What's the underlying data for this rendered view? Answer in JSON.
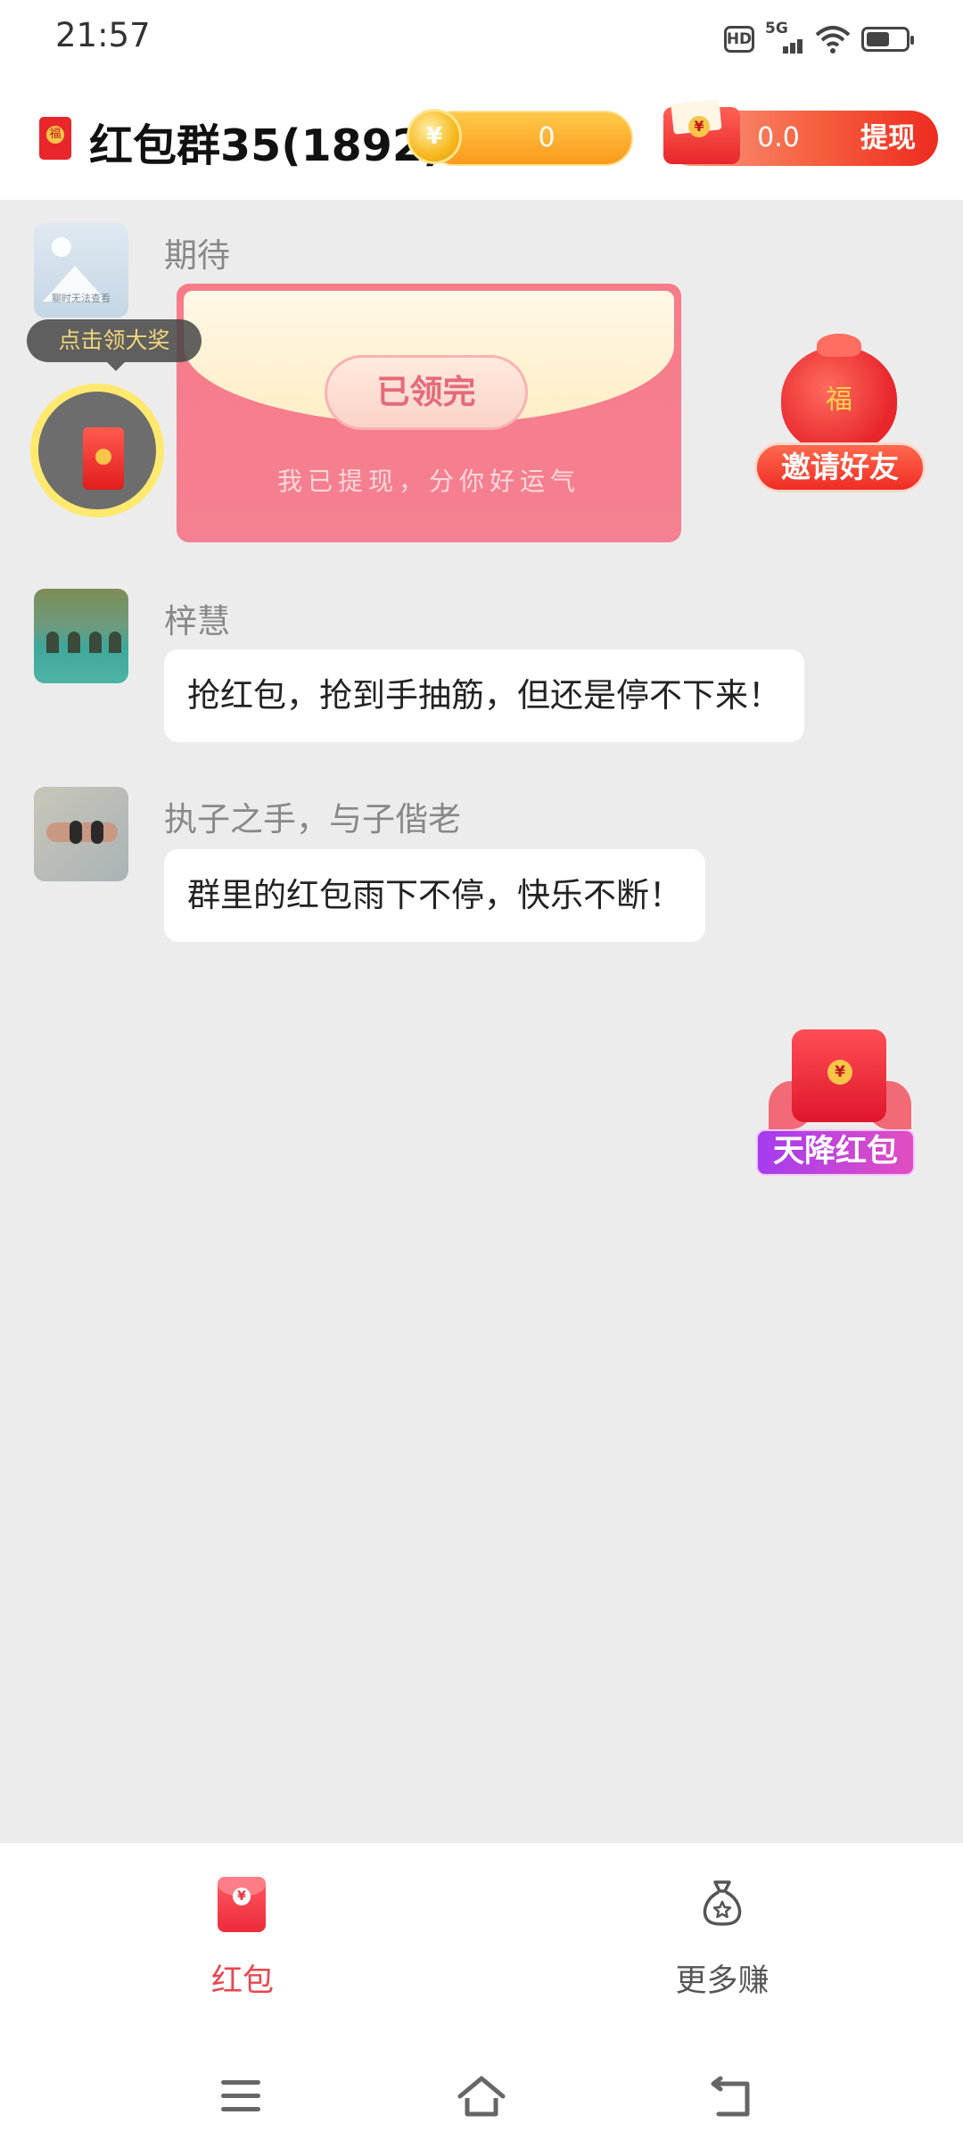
{
  "status_bar": {
    "time": "21:57",
    "hd_badge": "HD",
    "network": "5G",
    "battery_level": 0.6,
    "icons": [
      "hd-icon",
      "signal-5g-icon",
      "wifi-icon",
      "battery-icon"
    ]
  },
  "header": {
    "title": "红包群35(1892)",
    "coins": {
      "icon": "coin-icon",
      "value": "0"
    },
    "cash": {
      "icon": "red-envelope-icon",
      "value": "0.0",
      "withdraw_label": "提现"
    }
  },
  "chat": {
    "messages": [
      {
        "sender": "期待",
        "type": "red_envelope",
        "envelope_status": "已领完",
        "envelope_note": "我已提现，分你好运气",
        "avatar_caption": "聊时无法查看"
      },
      {
        "sender": "梓慧",
        "type": "text",
        "text": "抢红包，抢到手抽筋，但还是停不下来！"
      },
      {
        "sender": "执子之手，与子偕老",
        "type": "text",
        "text": "群里的红包雨下不停，快乐不断！"
      }
    ]
  },
  "floating": {
    "prize_tip": "点击领大奖",
    "invite_label": "邀请好友",
    "redpacket_rain_label": "天降红包"
  },
  "tabbar": {
    "tabs": [
      {
        "label": "红包",
        "icon": "red-envelope-icon",
        "active": true
      },
      {
        "label": "更多赚",
        "icon": "money-bag-icon",
        "active": false
      }
    ],
    "active_color": "#e74650"
  },
  "navbar": {
    "icons": [
      "menu-icon",
      "home-icon",
      "back-icon"
    ]
  }
}
